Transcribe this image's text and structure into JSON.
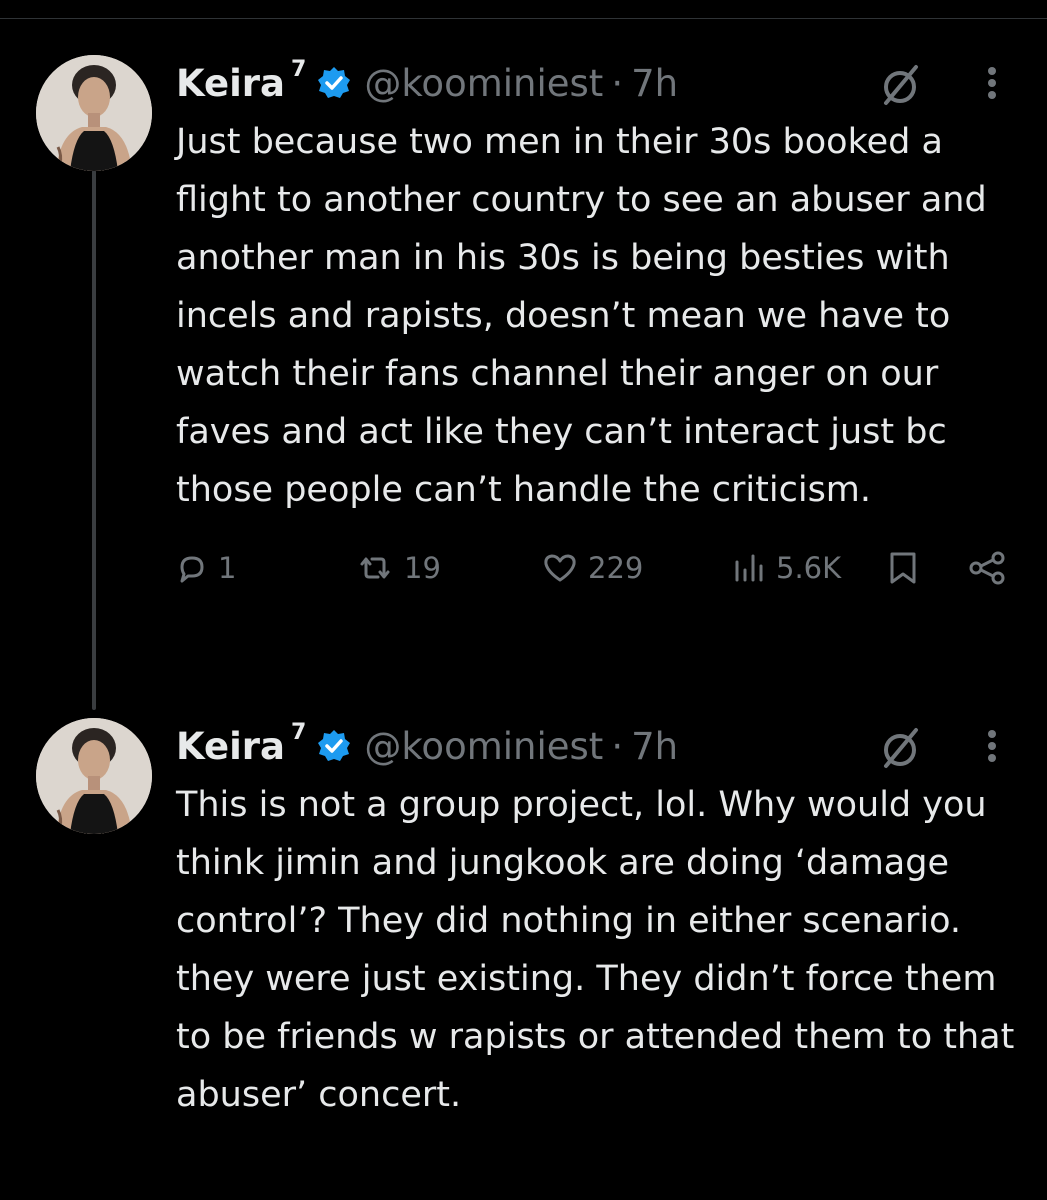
{
  "tweets": [
    {
      "author": {
        "name": "Keira",
        "superscript": "7",
        "handle": "@koominiest",
        "time": "7h",
        "verified": true
      },
      "text": "Just because two men in their 30s booked a flight to another country to see an abuser and another man in his 30s is being besties with incels and rapists, doesn’t mean we have to watch their fans channel their anger on our faves and act like they can’t interact just bc those people can’t handle the criticism.",
      "stats": {
        "replies": "1",
        "reposts": "19",
        "likes": "229",
        "views": "5.6K"
      },
      "icons": [
        "reply-icon",
        "repost-icon",
        "like-icon",
        "views-icon",
        "bookmark-icon",
        "share-icon"
      ]
    },
    {
      "author": {
        "name": "Keira",
        "superscript": "7",
        "handle": "@koominiest",
        "time": "7h",
        "verified": true
      },
      "text": "This is not a group project, lol. Why would you think jimin and jungkook are doing ‘damage control’? They did nothing in either scenario. they were just existing. They didn’t force them to be friends w rapists or attended them to that abuser’ concert."
    }
  ],
  "header_separator": "·",
  "colors": {
    "background": "#000000",
    "text": "#e7e9ea",
    "muted": "#71767b",
    "verified": "#1d9bf0",
    "thread_line": "#3a3d40"
  }
}
